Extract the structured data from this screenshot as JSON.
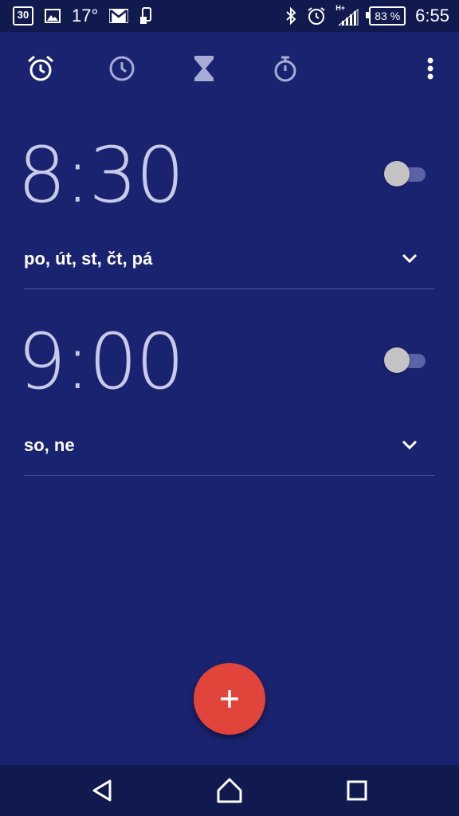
{
  "status_bar": {
    "calendar_day": "30",
    "temperature": "17°",
    "battery": "83 %",
    "network": "H+",
    "time": "6:55"
  },
  "toolbar": {
    "icons": [
      "alarm-icon",
      "clock-icon",
      "timer-icon",
      "stopwatch-icon",
      "more-options-icon"
    ]
  },
  "alarms": [
    {
      "time": "8:30",
      "days": "po, út, st, čt, pá",
      "enabled": false
    },
    {
      "time": "9:00",
      "days": "so, ne",
      "enabled": false
    }
  ],
  "colors": {
    "background": "#1a2370",
    "status_bar": "#101a4f",
    "fab": "#e0443a",
    "time_text": "#c7cbe8"
  }
}
